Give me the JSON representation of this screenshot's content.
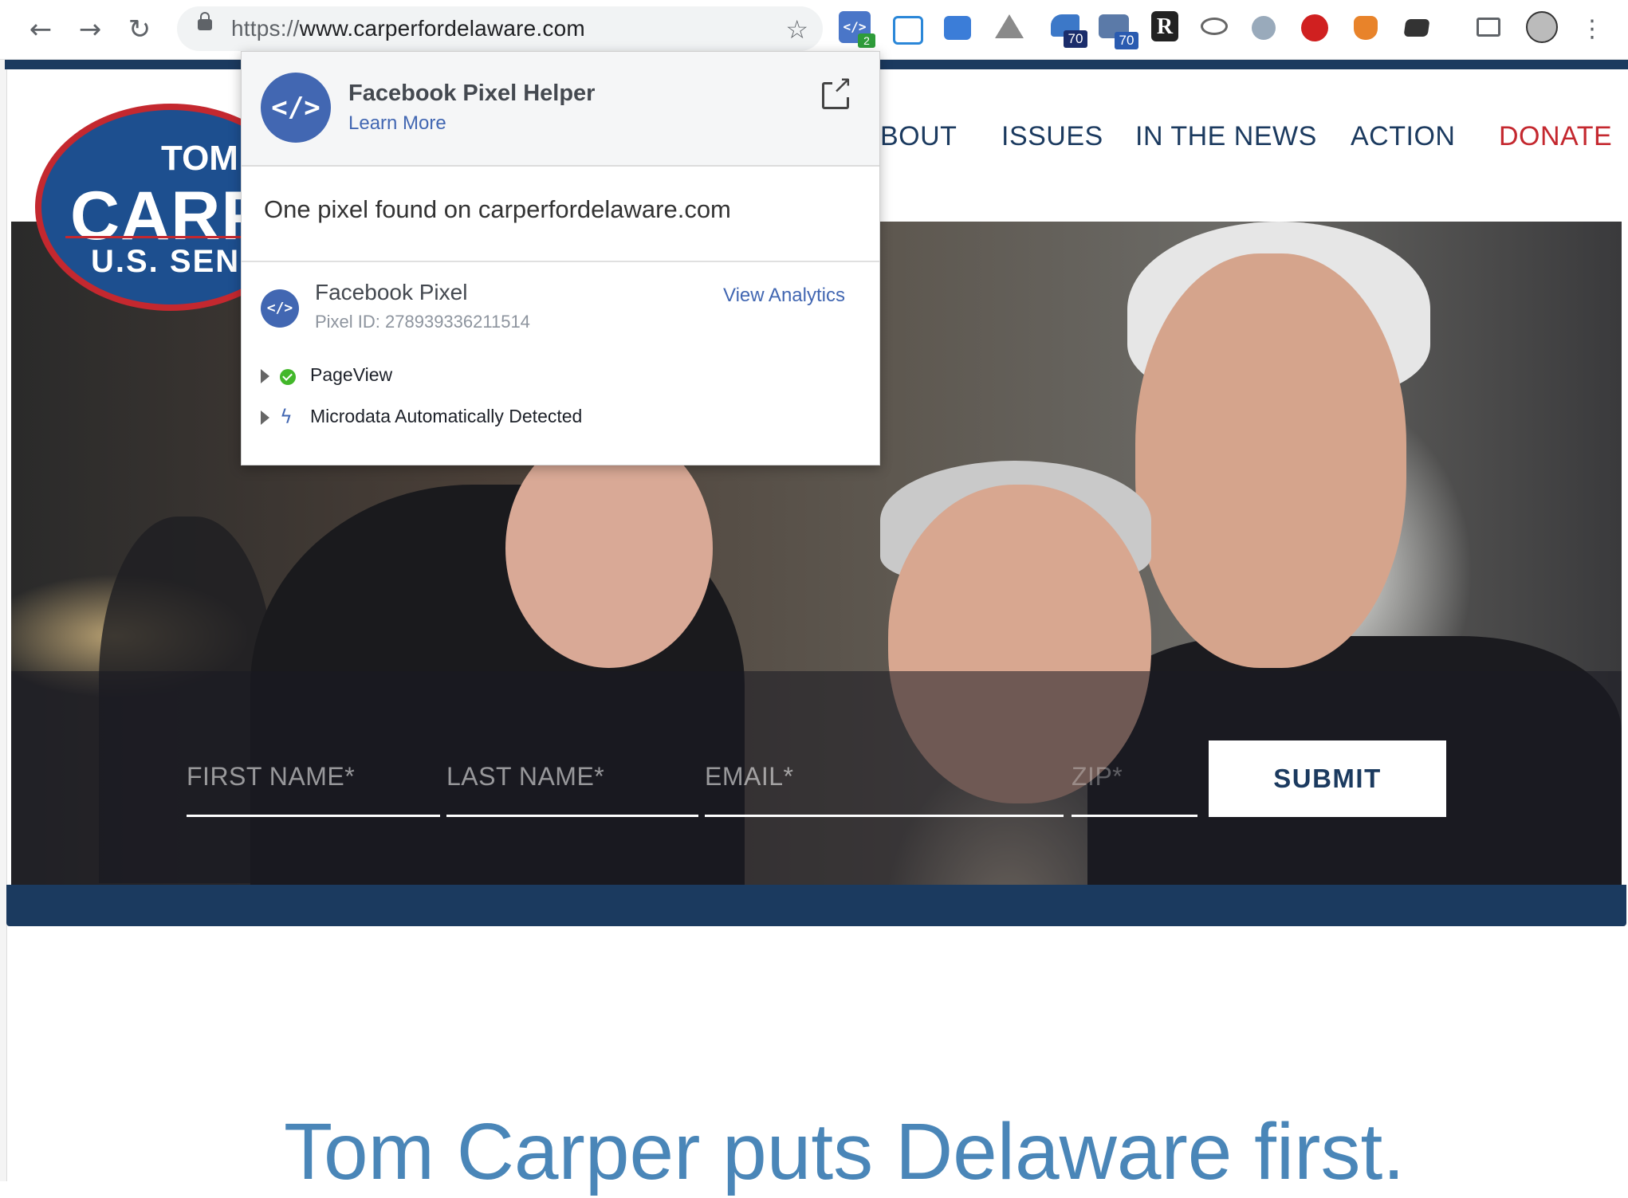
{
  "browser": {
    "url_scheme": "https://",
    "url_host": "www.carperfordelaware.com",
    "extension_badges": {
      "pixel_helper": "2",
      "ext_a": "70",
      "ext_b": "70"
    },
    "icons": [
      "back-icon",
      "forward-icon",
      "reload-icon",
      "lock-icon",
      "bookmark-star-icon",
      "cast-icon",
      "profile-avatar",
      "menu-kebab-icon"
    ]
  },
  "site": {
    "logo": {
      "line1": "TOM",
      "line2": "CARP",
      "line3": "U.S. SEN"
    },
    "nav": [
      "BOUT",
      "ISSUES",
      "IN THE NEWS",
      "ACTION",
      "DONATE"
    ],
    "form": {
      "first_name": "FIRST NAME*",
      "last_name": "LAST NAME*",
      "email": "EMAIL*",
      "zip": "ZIP*",
      "submit": "SUBMIT"
    },
    "tagline": "Tom Carper puts Delaware first.",
    "colors": {
      "navy": "#1b3a5f",
      "donate_red": "#c4282f",
      "tagline_blue": "#4a86b8"
    }
  },
  "popup": {
    "title": "Facebook Pixel Helper",
    "learn_more": "Learn More",
    "found_text": "One pixel found on carperfordelaware.com",
    "pixel": {
      "name": "Facebook Pixel",
      "id_text": "Pixel ID: 278939336211514",
      "view_analytics": "View Analytics"
    },
    "events": [
      {
        "label": "PageView",
        "status": "success"
      },
      {
        "label": "Microdata Automatically Detected",
        "status": "auto"
      }
    ],
    "colors": {
      "facebook_blue": "#4267b2",
      "success_green": "#42b72a"
    }
  }
}
